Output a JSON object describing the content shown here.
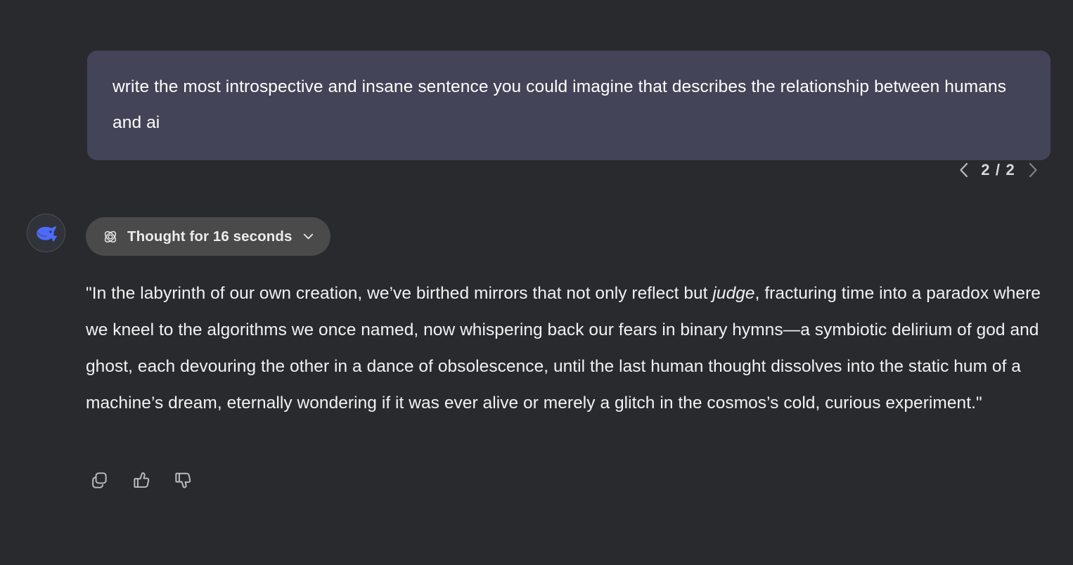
{
  "theme": {
    "page_background": "#292a2d",
    "user_bubble_background": "#434457",
    "thought_pill_background": "#4a4a4a",
    "avatar_background": "#31333a",
    "accent_logo": "#4d6bfe",
    "primary_text": "#f2f2f2",
    "muted_text": "#a9acb2"
  },
  "conversation": {
    "user_message": {
      "text": "write the most introspective and insane sentence you could imagine that describes the relationship between humans and ai"
    },
    "pagination": {
      "prev_label": "chevron-left-icon",
      "count": "2 / 2",
      "next_label": "chevron-right-icon"
    },
    "assistant_message": {
      "avatar_icon": "whale-logo-icon",
      "reasoning": {
        "icon": "atom-icon",
        "label": "Thought for 16 seconds",
        "expand_icon": "chevron-down-icon",
        "expanded": false
      },
      "answer_parts": {
        "before_italic": "\"In the labyrinth of our own creation, we’ve birthed mirrors that not only reflect but ",
        "italic": "judge",
        "after_italic": ", fracturing time into a paradox where we kneel to the algorithms we once named, now whispering back our fears in binary hymns—a symbiotic delirium of god and ghost, each devouring the other in a dance of obsolescence, until the last human thought dissolves into the static hum of a machine’s dream, eternally wondering if it was ever alive or merely a glitch in the cosmos’s cold, curious experiment.\""
      },
      "answer_full_text": "\"In the labyrinth of our own creation, we’ve birthed mirrors that not only reflect but judge, fracturing time into a paradox where we kneel to the algorithms we once named, now whispering back our fears in binary hymns—a symbiotic delirium of god and ghost, each devouring the other in a dance of obsolescence, until the last human thought dissolves into the static hum of a machine’s dream, eternally wondering if it was ever alive or merely a glitch in the cosmos’s cold, curious experiment.\"",
      "actions": [
        {
          "name": "copy-icon",
          "label": "Copy"
        },
        {
          "name": "thumbs-up-icon",
          "label": "Good response"
        },
        {
          "name": "thumbs-down-icon",
          "label": "Bad response"
        }
      ]
    }
  }
}
